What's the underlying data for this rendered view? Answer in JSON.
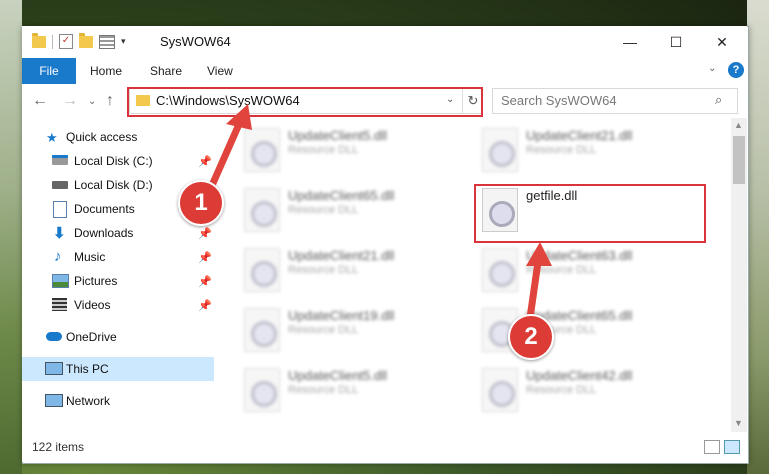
{
  "window": {
    "title": "SysWOW64"
  },
  "ribbon": {
    "tabs": [
      "File",
      "Home",
      "Share",
      "View"
    ]
  },
  "address": {
    "path": "C:\\Windows\\SysWOW64"
  },
  "search": {
    "placeholder": "Search SysWOW64"
  },
  "sidebar": {
    "items": [
      {
        "label": "Quick access",
        "icon": "star-icon",
        "pinned": false
      },
      {
        "label": "Local Disk (C:)",
        "icon": "drive-icon",
        "pinned": true
      },
      {
        "label": "Local Disk (D:)",
        "icon": "drive-icon",
        "pinned": false
      },
      {
        "label": "Documents",
        "icon": "documents-icon",
        "pinned": true
      },
      {
        "label": "Downloads",
        "icon": "download-icon",
        "pinned": true
      },
      {
        "label": "Music",
        "icon": "music-icon",
        "pinned": true
      },
      {
        "label": "Pictures",
        "icon": "pictures-icon",
        "pinned": true
      },
      {
        "label": "Videos",
        "icon": "videos-icon",
        "pinned": true
      },
      {
        "label": "OneDrive",
        "icon": "cloud-icon",
        "pinned": false
      },
      {
        "label": "This PC",
        "icon": "computer-icon",
        "pinned": false
      },
      {
        "label": "Network",
        "icon": "network-icon",
        "pinned": false
      }
    ]
  },
  "files": {
    "col1": [
      {
        "name": "UpdateClient5.dll",
        "type": "Resource DLL"
      },
      {
        "name": "UpdateClient65.dll",
        "type": "Resource DLL"
      },
      {
        "name": "UpdateClient21.dll",
        "type": "Resource DLL"
      },
      {
        "name": "UpdateClient19.dll",
        "type": "Resource DLL"
      },
      {
        "name": "UpdateClient5.dll",
        "type": "Resource DLL"
      }
    ],
    "col2": [
      {
        "name": "UpdateClient21.dll",
        "type": "Resource DLL"
      },
      {
        "name": "getfile.dll",
        "type": ""
      },
      {
        "name": "UpdateClient63.dll",
        "type": "Resource DLL"
      },
      {
        "name": "UpdateClient65.dll",
        "type": "Resource DLL"
      },
      {
        "name": "UpdateClient42.dll",
        "type": "Resource DLL"
      }
    ]
  },
  "status": {
    "count": "122 items"
  },
  "annotations": {
    "step1": "1",
    "step2": "2",
    "color": "#d9343c"
  }
}
